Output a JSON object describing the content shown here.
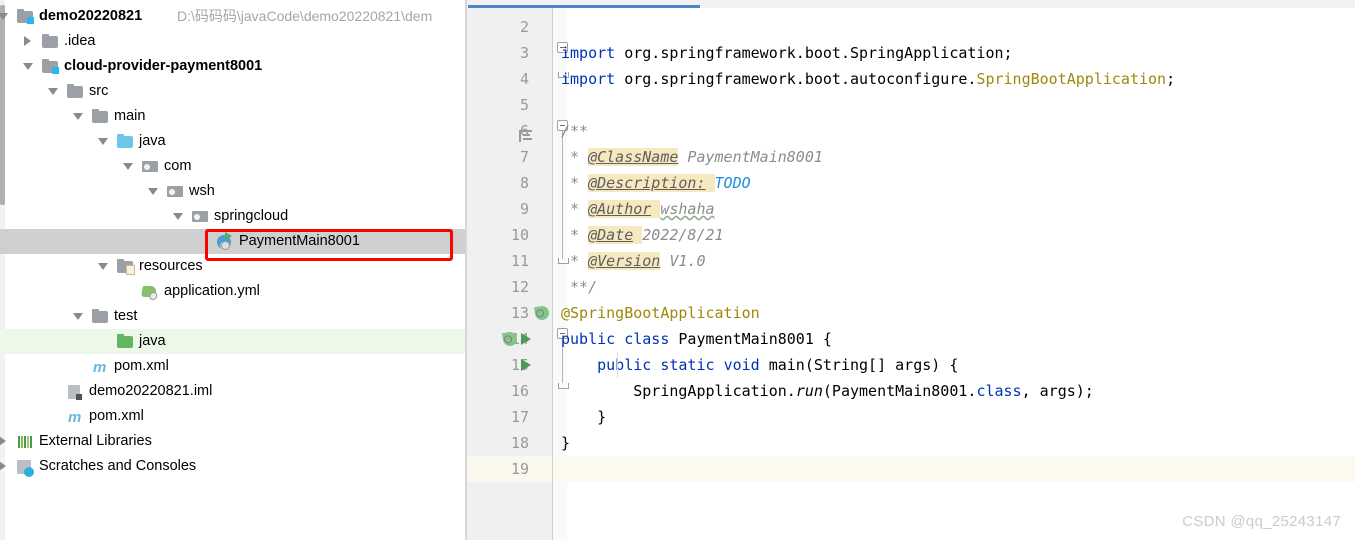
{
  "project_panel": {
    "scrollbar": "vertical-scrollbar",
    "tree": [
      {
        "label": "demo20220821",
        "path": "D:\\码码码\\javaCode\\demo20220821\\dem",
        "arrow": "down",
        "icon": "module-folder-icon",
        "bold": true,
        "indent": 0,
        "state": "normal"
      },
      {
        "label": ".idea",
        "path": "",
        "arrow": "right",
        "icon": "folder-icon",
        "bold": false,
        "indent": 1,
        "state": "normal"
      },
      {
        "label": "cloud-provider-payment8001",
        "path": "",
        "arrow": "down",
        "icon": "module-folder-icon",
        "bold": true,
        "indent": 1,
        "state": "normal"
      },
      {
        "label": "src",
        "path": "",
        "arrow": "down",
        "icon": "folder-icon",
        "bold": false,
        "indent": 2,
        "state": "normal"
      },
      {
        "label": "main",
        "path": "",
        "arrow": "down",
        "icon": "folder-icon",
        "bold": false,
        "indent": 3,
        "state": "normal"
      },
      {
        "label": "java",
        "path": "",
        "arrow": "down",
        "icon": "source-folder-icon",
        "bold": false,
        "indent": 4,
        "state": "normal"
      },
      {
        "label": "com",
        "path": "",
        "arrow": "down",
        "icon": "package-icon",
        "bold": false,
        "indent": 5,
        "state": "normal"
      },
      {
        "label": "wsh",
        "path": "",
        "arrow": "down",
        "icon": "package-icon",
        "bold": false,
        "indent": 6,
        "state": "normal"
      },
      {
        "label": "springcloud",
        "path": "",
        "arrow": "down",
        "icon": "package-icon",
        "bold": false,
        "indent": 7,
        "state": "normal"
      },
      {
        "label": "PaymentMain8001",
        "path": "",
        "arrow": "none",
        "icon": "java-class-runnable-icon",
        "bold": false,
        "indent": 8,
        "state": "selected"
      },
      {
        "label": "resources",
        "path": "",
        "arrow": "down",
        "icon": "resources-folder-icon",
        "bold": false,
        "indent": 4,
        "state": "normal"
      },
      {
        "label": "application.yml",
        "path": "",
        "arrow": "none",
        "icon": "spring-yaml-icon",
        "bold": false,
        "indent": 5,
        "state": "normal"
      },
      {
        "label": "test",
        "path": "",
        "arrow": "down",
        "icon": "folder-icon",
        "bold": false,
        "indent": 3,
        "state": "normal"
      },
      {
        "label": "java",
        "path": "",
        "arrow": "none",
        "icon": "test-source-folder-icon",
        "bold": false,
        "indent": 4,
        "state": "test-root"
      },
      {
        "label": "pom.xml",
        "path": "",
        "arrow": "none",
        "icon": "maven-file-icon",
        "bold": false,
        "indent": 3,
        "state": "normal"
      },
      {
        "label": "demo20220821.iml",
        "path": "",
        "arrow": "none",
        "icon": "iml-file-icon",
        "bold": false,
        "indent": 2,
        "state": "normal"
      },
      {
        "label": "pom.xml",
        "path": "",
        "arrow": "none",
        "icon": "maven-file-icon",
        "bold": false,
        "indent": 2,
        "state": "normal"
      },
      {
        "label": "External Libraries",
        "path": "",
        "arrow": "right",
        "icon": "libraries-icon",
        "bold": false,
        "indent": 0,
        "state": "normal"
      },
      {
        "label": "Scratches and Consoles",
        "path": "",
        "arrow": "right",
        "icon": "scratches-icon",
        "bold": false,
        "indent": 0,
        "state": "normal"
      }
    ],
    "annotation": {
      "shape": "red-rectangle",
      "target": "PaymentMain8001",
      "color": "#fe0000"
    }
  },
  "editor": {
    "active_tab_accent": "#4a86c8",
    "caret_line_number": 19,
    "lines": [
      {
        "num": "2",
        "segments": []
      },
      {
        "num": "3",
        "segments": [
          {
            "t": "import",
            "c": "kw"
          },
          {
            "t": " org.springframework.boot.SpringApplication;",
            "c": ""
          }
        ]
      },
      {
        "num": "4",
        "segments": [
          {
            "t": "import",
            "c": "kw"
          },
          {
            "t": " org.springframework.boot.autoconfigure.",
            "c": ""
          },
          {
            "t": "SpringBootApplication",
            "c": "anno"
          },
          {
            "t": ";",
            "c": ""
          }
        ]
      },
      {
        "num": "5",
        "segments": []
      },
      {
        "num": "6",
        "segments": [
          {
            "t": "/**",
            "c": "cmt"
          }
        ]
      },
      {
        "num": "7",
        "segments": [
          {
            "t": " * ",
            "c": "cmt"
          },
          {
            "t": "@ClassName",
            "c": "cmt-tag"
          },
          {
            "t": " PaymentMain8001",
            "c": "cmt"
          }
        ]
      },
      {
        "num": "8",
        "segments": [
          {
            "t": " * ",
            "c": "cmt"
          },
          {
            "t": "@Description:",
            "c": "cmt-tag"
          },
          {
            "t": " ",
            "c": "cmt-hl"
          },
          {
            "t": "TODO",
            "c": "todo"
          }
        ]
      },
      {
        "num": "9",
        "segments": [
          {
            "t": " * ",
            "c": "cmt"
          },
          {
            "t": "@Author",
            "c": "cmt-tag"
          },
          {
            "t": " ",
            "c": "cmt-hl"
          },
          {
            "t": "wshaha",
            "c": "cmt wavy"
          }
        ]
      },
      {
        "num": "10",
        "segments": [
          {
            "t": " * ",
            "c": "cmt"
          },
          {
            "t": "@Date",
            "c": "cmt-tag"
          },
          {
            "t": " ",
            "c": "cmt-hl"
          },
          {
            "t": "2022/8/21",
            "c": "cmt"
          }
        ]
      },
      {
        "num": "11",
        "segments": [
          {
            "t": " * ",
            "c": "cmt"
          },
          {
            "t": "@Version",
            "c": "cmt-tag"
          },
          {
            "t": " V1.0",
            "c": "cmt"
          }
        ]
      },
      {
        "num": "12",
        "segments": [
          {
            "t": " **/",
            "c": "cmt"
          }
        ]
      },
      {
        "num": "13",
        "segments": [
          {
            "t": "@SpringBootApplication",
            "c": "anno"
          }
        ],
        "gutter": [
          "spring-bean-icon"
        ]
      },
      {
        "num": "14",
        "segments": [
          {
            "t": "public",
            "c": "kw"
          },
          {
            "t": " ",
            "c": ""
          },
          {
            "t": "class",
            "c": "kw"
          },
          {
            "t": " PaymentMain8001 {",
            "c": ""
          }
        ],
        "gutter": [
          "spring-bean-icon",
          "run-icon"
        ]
      },
      {
        "num": "15",
        "segments": [
          {
            "t": "    ",
            "c": ""
          },
          {
            "t": "public",
            "c": "kw"
          },
          {
            "t": " ",
            "c": ""
          },
          {
            "t": "static",
            "c": "kw"
          },
          {
            "t": " ",
            "c": ""
          },
          {
            "t": "void",
            "c": "kw"
          },
          {
            "t": " main(String[] args) {",
            "c": ""
          }
        ],
        "gutter": [
          "run-icon"
        ]
      },
      {
        "num": "16",
        "segments": [
          {
            "t": "        SpringApplication.",
            "c": ""
          },
          {
            "t": "run",
            "c": "ital"
          },
          {
            "t": "(PaymentMain8001.",
            "c": ""
          },
          {
            "t": "class",
            "c": "kw"
          },
          {
            "t": ", args);",
            "c": ""
          }
        ]
      },
      {
        "num": "17",
        "segments": [
          {
            "t": "    }",
            "c": ""
          }
        ]
      },
      {
        "num": "18",
        "segments": [
          {
            "t": "}",
            "c": ""
          }
        ]
      },
      {
        "num": "19",
        "segments": []
      }
    ]
  },
  "watermark": {
    "text": "CSDN @qq_25243147"
  }
}
